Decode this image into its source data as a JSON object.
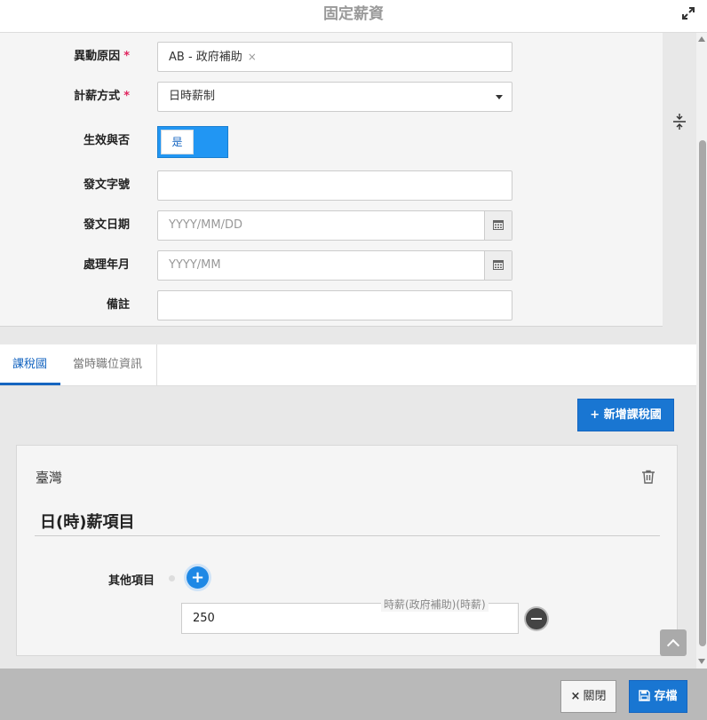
{
  "header": {
    "title": "固定薪資"
  },
  "form": {
    "reason": {
      "label": "異動原因",
      "required_mark": "*",
      "tag": "AB - 政府補助",
      "remove": "×"
    },
    "pay_method": {
      "label": "計薪方式",
      "required_mark": "*",
      "value": "日時薪制"
    },
    "effective": {
      "label": "生效與否",
      "toggle_text": "是"
    },
    "doc_number": {
      "label": "發文字號",
      "value": ""
    },
    "doc_date": {
      "label": "發文日期",
      "placeholder": "YYYY/MM/DD"
    },
    "process_month": {
      "label": "處理年月",
      "placeholder": "YYYY/MM"
    },
    "remark": {
      "label": "備註",
      "value": ""
    }
  },
  "tabs": [
    {
      "label": "課稅國"
    },
    {
      "label": "當時職位資訊"
    }
  ],
  "add_country_button": "+ 新增課稅國",
  "card": {
    "country": "臺灣",
    "section_title": "日(時)薪項目",
    "other_label": "其他項目",
    "plus": "+",
    "item_label": "時薪(政府補助)(時薪)",
    "item_value": "250"
  },
  "footer": {
    "close_icon": "×",
    "close_label": "關閉",
    "save_label": "存檔"
  },
  "icons": {
    "expand": "expand-icon",
    "calendar": "calendar-icon",
    "trash": "trash-icon",
    "save": "floppy-icon"
  },
  "colors": {
    "primary": "#1976d2",
    "toggle_on": "#2196f3",
    "required": "#e0245e"
  }
}
